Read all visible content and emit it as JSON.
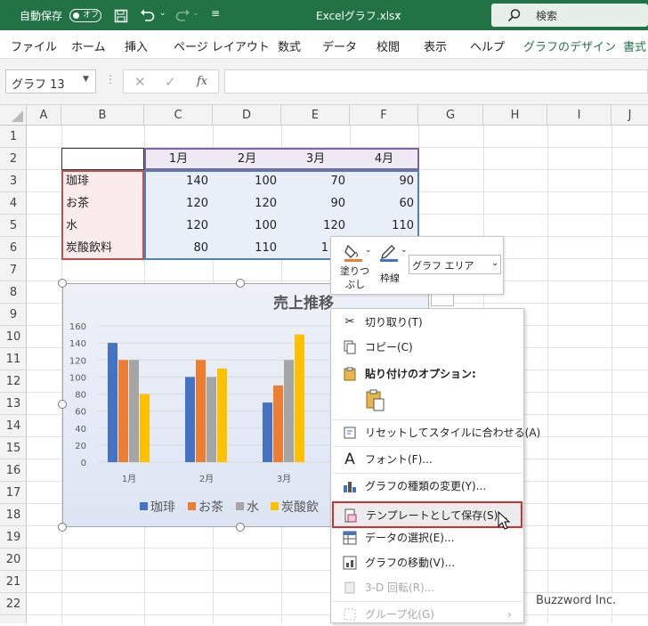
{
  "titlebar": {
    "autosave": "自動保存",
    "autosave_state": "オフ",
    "filename": "Excelグラフ.xlsx",
    "search": "検索"
  },
  "ribbon_tabs": [
    "ファイル",
    "ホーム",
    "挿入",
    "ページ レイアウト",
    "数式",
    "データ",
    "校閲",
    "表示",
    "ヘルプ",
    "グラフのデザイン",
    "書式"
  ],
  "namebox": "グラフ 13",
  "formula_fx": "fx",
  "columns": [
    "A",
    "B",
    "C",
    "D",
    "E",
    "F",
    "G",
    "H",
    "I",
    "J"
  ],
  "rows": [
    "1",
    "2",
    "3",
    "4",
    "5",
    "6",
    "7",
    "8",
    "9",
    "10",
    "11",
    "12",
    "13",
    "14",
    "15",
    "16",
    "17",
    "18",
    "19",
    "20",
    "21",
    "22"
  ],
  "table": {
    "months": [
      "1月",
      "2月",
      "3月",
      "4月"
    ],
    "items": [
      {
        "name": "珈琲",
        "values": [
          "140",
          "100",
          "70",
          "90"
        ]
      },
      {
        "name": "お茶",
        "values": [
          "120",
          "120",
          "90",
          "60"
        ]
      },
      {
        "name": "水",
        "values": [
          "120",
          "100",
          "120",
          "110"
        ]
      },
      {
        "name": "炭酸飲料",
        "values": [
          "80",
          "110",
          "1",
          ""
        ]
      }
    ]
  },
  "chart_data": {
    "type": "bar",
    "title": "売上推移",
    "categories": [
      "1月",
      "2月",
      "3月"
    ],
    "series": [
      {
        "name": "珈琲",
        "values": [
          140,
          100,
          70
        ],
        "color": "#4472c4"
      },
      {
        "name": "お茶",
        "values": [
          120,
          120,
          90
        ],
        "color": "#ed7d31"
      },
      {
        "name": "水",
        "values": [
          120,
          100,
          120
        ],
        "color": "#a5a5a5"
      },
      {
        "name": "炭酸飲",
        "values": [
          80,
          110,
          150
        ],
        "color": "#ffc000"
      }
    ],
    "yticks": [
      "160",
      "140",
      "120",
      "100",
      "80",
      "60",
      "40",
      "20",
      "0"
    ],
    "ylim": [
      0,
      160
    ]
  },
  "mini_toolbar": {
    "fill_label_1": "塗りつ",
    "fill_label_2": "ぶし",
    "outline_label": "枠線",
    "element_select": "グラフ エリア"
  },
  "context_menu": {
    "cut": "切り取り(T)",
    "copy": "コピー(C)",
    "paste_options": "貼り付けのオプション:",
    "reset_style": "リセットしてスタイルに合わせる(A)",
    "font": "フォント(F)...",
    "change_type": "グラフの種類の変更(Y)...",
    "save_template": "テンプレートとして保存(S)...",
    "select_data": "データの選択(E)...",
    "move_chart": "グラフの移動(V)...",
    "rotation_3d": "3-D 回転(R)...",
    "group": "グループ化(G)"
  },
  "watermark": "Buzzword Inc."
}
